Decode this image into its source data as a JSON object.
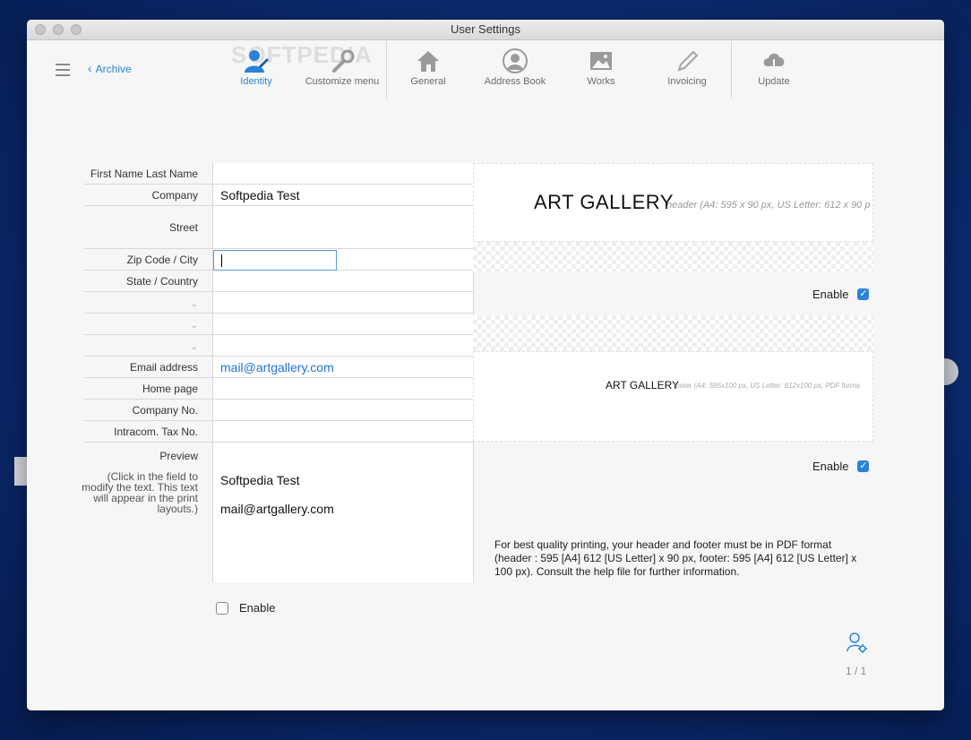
{
  "window": {
    "title": "User Settings"
  },
  "watermark": "SOFTPEDIA",
  "nav": {
    "back_label": "Archive"
  },
  "toolbar": {
    "items": [
      {
        "label": "Identity",
        "icon": "identity-icon",
        "active": true
      },
      {
        "label": "Customize menu",
        "icon": "wrench-icon",
        "active": false
      },
      {
        "label": "General",
        "icon": "home-icon",
        "active": false
      },
      {
        "label": "Address Book",
        "icon": "person-icon",
        "active": false
      },
      {
        "label": "Works",
        "icon": "image-icon",
        "active": false
      },
      {
        "label": "Invoicing",
        "icon": "pencil-icon",
        "active": false
      },
      {
        "label": "Update",
        "icon": "cloud-download-icon",
        "active": false
      }
    ]
  },
  "form": {
    "labels": {
      "name": "First Name Last Name",
      "company": "Company",
      "street": "Street",
      "zip": "Zip Code / City",
      "state": "State / Country",
      "email": "Email address",
      "homepage": "Home page",
      "companyno": "Company No.",
      "tax": "Intracom. Tax No.",
      "preview": "Preview",
      "preview_note": "(Click in the field to modify the text. This text will appear in the print layouts.)"
    },
    "values": {
      "name": "",
      "company": "Softpedia Test",
      "street": "",
      "zip": "",
      "state": "",
      "email": "mail@artgallery.com",
      "homepage": "",
      "companyno": "",
      "tax": "",
      "preview_line1": "Softpedia Test",
      "preview_line2": "mail@artgallery.com"
    },
    "enable_label": "Enable",
    "enable_checked": false
  },
  "header_panel": {
    "logo_text": "ART GALLERY",
    "hint": "header  (A4: 595 x 90 px, US Letter: 612 x 90 p",
    "enable_label": "Enable",
    "enable_checked": true
  },
  "footer_panel": {
    "logo_text": "ART GALLERY",
    "hint": "footer (A4: 595x100 px, US Letter: 612x100 px, PDF forma",
    "enable_label": "Enable",
    "enable_checked": true
  },
  "info_text": "For best quality printing, your header and footer must be in PDF format (header : 595 [A4] 612 [US Letter] x 90 px, footer: 595 [A4] 612 [US Letter] x 100 px). Consult the help file for further information.",
  "pager": "1 / 1",
  "colors": {
    "accent": "#2b83d9",
    "link": "#1f73d1",
    "desktop": "#0b2a6e"
  }
}
